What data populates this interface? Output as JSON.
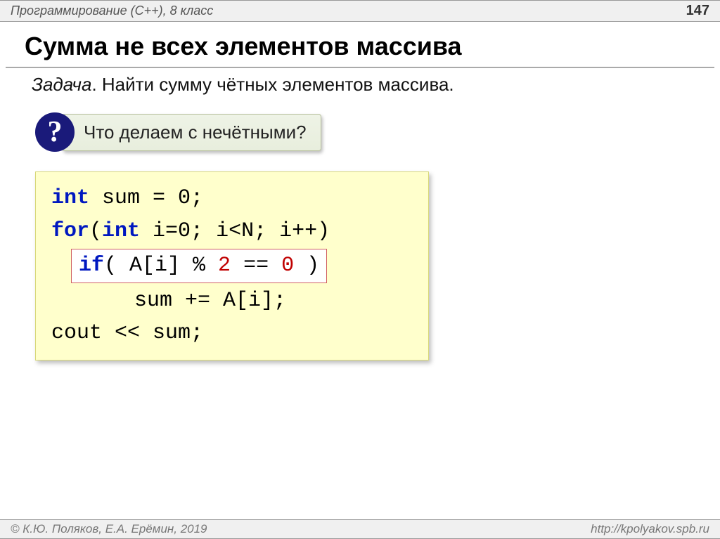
{
  "header": {
    "left": "Программирование (C++), 8 класс",
    "page": "147"
  },
  "title": "Сумма не всех элементов массива",
  "task": {
    "label": "Задача",
    "text": ". Найти сумму чётных элементов массива."
  },
  "hint": {
    "mark": "?",
    "text": " Что делаем с нечётными?"
  },
  "code": {
    "l1_kw": "int",
    "l1_rest": " sum = 0;",
    "l2_kw": "for",
    "l2_a": "(",
    "l2_kw2": "int",
    "l2_b": " i=0; i<N; i++)",
    "l3_kw": "if",
    "l3_a": "( A[i] % ",
    "l3_num": "2",
    "l3_b": " == ",
    "l3_num2": "0",
    "l3_c": " )",
    "l4": "sum += A[i];",
    "l5": "cout << sum;"
  },
  "footer": {
    "left": "© К.Ю. Поляков, Е.А. Ерёмин, 2019",
    "right": "http://kpolyakov.spb.ru"
  }
}
